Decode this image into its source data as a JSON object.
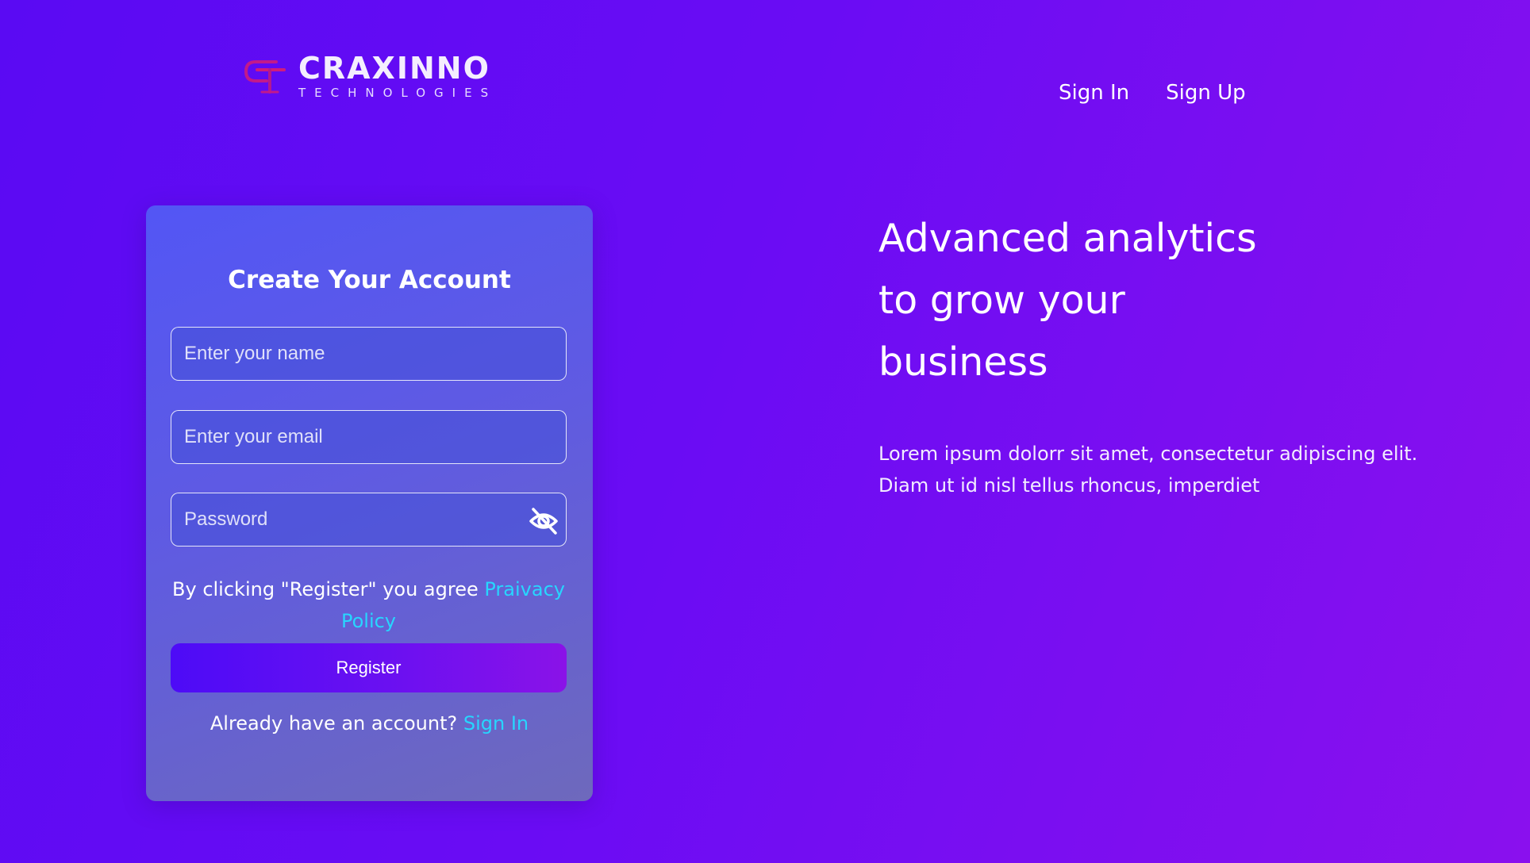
{
  "brand": {
    "name": "CRAXINNO",
    "tagline": "TECHNOLOGIES"
  },
  "nav": {
    "sign_in": "Sign In",
    "sign_up": "Sign Up"
  },
  "form": {
    "title": "Create Your Account",
    "name_placeholder": "Enter your name",
    "email_placeholder": "Enter your email",
    "password_placeholder": "Password",
    "password_toggle_icon": "eye-off-icon",
    "agree_text": "By clicking \"Register\" you agree ",
    "privacy_link": "Praivacy Policy",
    "register_label": "Register",
    "already_text": "Already have an account? ",
    "signin_link": "Sign In"
  },
  "hero": {
    "title_lines": [
      "Advanced analytics",
      "to grow your",
      "business"
    ],
    "description_lines": [
      "Lorem ipsum dolorr sit amet, consectetur adipiscing elit.",
      "Diam ut id nisl tellus rhoncus, imperdiet"
    ]
  },
  "colors": {
    "background_start": "#5a0af3",
    "background_end": "#8a10ee",
    "link": "#27d6ff",
    "button_start": "#4d0bf7",
    "button_end": "#8a12e8"
  }
}
